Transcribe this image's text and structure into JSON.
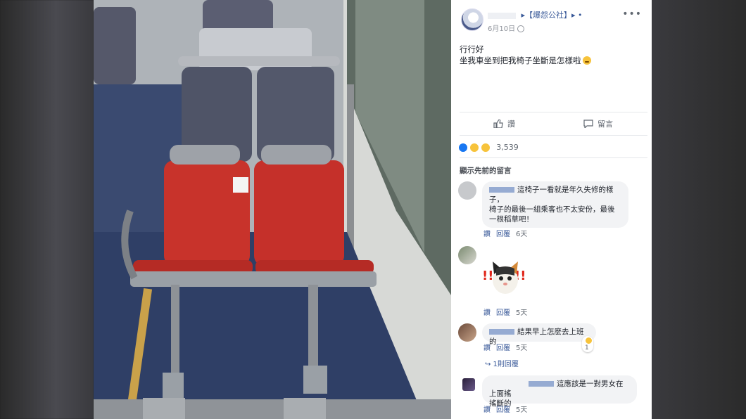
{
  "post": {
    "page_name": "▸【爆怨公社】▸",
    "date": "6月10日",
    "more": "•••",
    "text_line1": "行行好",
    "text_line2": "坐我車坐到把我椅子坐斷是怎樣啦",
    "like_label": "讚",
    "comment_label": "留言",
    "reaction_count": "3,539",
    "show_previous": "顯示先前的留言"
  },
  "comments": [
    {
      "text": "這椅子一看就是年久失修的樣子，\n椅子的最後一組乘客也不太安份，最後一根稻草吧！",
      "like": "讚",
      "reply": "回覆",
      "age": "6天"
    },
    {
      "text": "",
      "like": "讚",
      "reply": "回覆",
      "age": "5天"
    },
    {
      "text": "結果早上怎麼去上班的",
      "like": "讚",
      "reply": "回覆",
      "age": "5天",
      "reaction_count": "1",
      "replies_label": "↪ 1則回覆"
    },
    {
      "text": "這應該是一對男女在上面搖\n搖斷的",
      "like": "讚",
      "reply": "回覆",
      "age": "5天"
    }
  ],
  "colors": {
    "link": "#385898",
    "meta": "#606770",
    "bubble": "#f2f3f5",
    "seat_red": "#c8332b"
  },
  "icons": [
    "globe-icon",
    "thumbs-up-icon",
    "comment-icon",
    "like-reaction-icon",
    "haha-reaction-icon",
    "wow-reaction-icon",
    "more-icon"
  ]
}
